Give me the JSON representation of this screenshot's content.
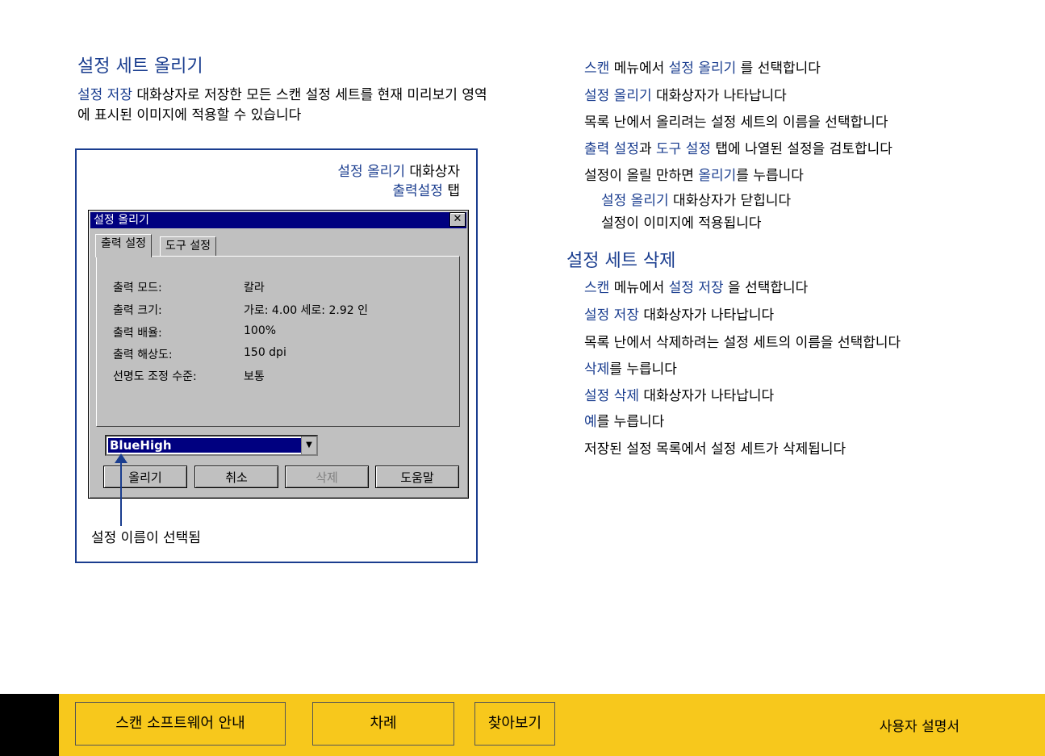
{
  "left": {
    "title": "설정 세트 올리기",
    "intro_lead": "설정 저장",
    "intro_rest": " 대화상자로 저장한 모든 스캔 설정 세트를 현재 미리보기 영역에 표시된 이미지에 적용할 수 있습니다"
  },
  "figure": {
    "caption1_blue": "설정 올리기",
    "caption1_rest": " 대화상자",
    "caption2_blue": "출력설정",
    "caption2_rest": " 탭",
    "callout": "설정 이름이 선택됨",
    "dialog": {
      "title": "설정 올리기",
      "close": "✕",
      "tabs": [
        "출력 설정",
        "도구 설정"
      ],
      "rows": [
        {
          "label": "출력 모드:",
          "value": "칼라"
        },
        {
          "label": "출력 크기:",
          "value": "가로: 4.00 세로: 2.92 인"
        },
        {
          "label": "출력 배율:",
          "value": "100%"
        },
        {
          "label": "출력 해상도:",
          "value": "150 dpi"
        },
        {
          "label": "선명도 조정 수준:",
          "value": "보통"
        }
      ],
      "combo_value": "BlueHigh",
      "combo_arrow": "▼",
      "buttons": [
        "올리기",
        "취소",
        "삭제",
        "도움말"
      ]
    }
  },
  "right": {
    "load_steps": [
      {
        "blue": "스캔",
        "text": " 메뉴에서 ",
        "blue2": "설정 올리기",
        "text2": "   를 선택합니다"
      },
      {
        "blue": "설정 올리기",
        "text": " 대화상자가 나타납니다"
      },
      {
        "blue": "",
        "text": "목록 난에서 올리려는 설정 세트의 이름을 선택합니다"
      },
      {
        "blue": "출력 설정",
        "text": "과 ",
        "blue2": "도구 설정",
        "text2": " 탭에 나열된 설정을 검토합니다"
      },
      {
        "blue": "",
        "text": "설정이 올릴 만하면 ",
        "blue2": "올리기",
        "text2": "를 누릅니다"
      }
    ],
    "load_results": [
      {
        "blue": "설정 올리기",
        "text": " 대화상자가 닫힙니다"
      },
      {
        "blue": "",
        "text": "설정이 이미지에 적용됩니다"
      }
    ],
    "delete_title": "설정 세트 삭제",
    "delete_steps": [
      {
        "blue": "스캔",
        "text": " 메뉴에서 ",
        "blue2": "설정 저장",
        "text2": "   을 선택합니다"
      },
      {
        "blue": "설정 저장",
        "text": " 대화상자가 나타납니다"
      },
      {
        "blue": "",
        "text": "목록 난에서 삭제하려는 설정 세트의 이름을 선택합니다"
      },
      {
        "blue": "삭제",
        "text": "를 누릅니다"
      },
      {
        "blue": "설정 삭제",
        "text": " 대화상자가 나타납니다"
      },
      {
        "blue": "예",
        "text": "를 누릅니다"
      },
      {
        "blue": "",
        "text": "저장된 설정 목록에서 설정 세트가 삭제됩니다"
      }
    ]
  },
  "footer": {
    "buttons": [
      "스캔 소프트웨어 안내",
      "차례",
      "찾아보기"
    ],
    "manual": "사용자 설명서"
  }
}
